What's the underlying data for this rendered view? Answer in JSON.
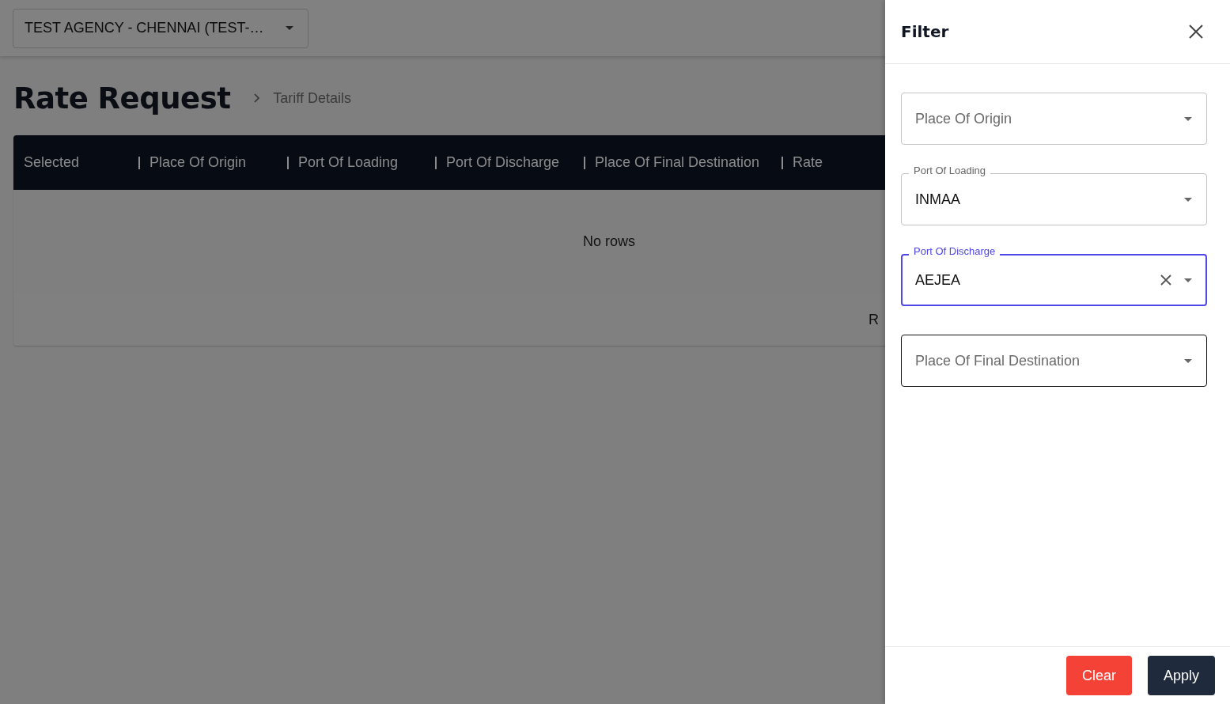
{
  "agency_select": {
    "value": "TEST AGENCY - CHENNAI  (TEST-…"
  },
  "page": {
    "title": "Rate Request",
    "breadcrumb": "Tariff Details"
  },
  "table": {
    "columns": [
      "Selected",
      "Place Of Origin",
      "Port Of Loading",
      "Port Of Discharge",
      "Place Of Final Destination",
      "Rate"
    ],
    "empty_text": "No rows",
    "footer_text": "R"
  },
  "filter": {
    "title": "Filter",
    "fields": [
      {
        "label": "Place Of Origin",
        "focused": false,
        "hovered": false
      },
      {
        "label": "Port Of Loading",
        "value": "INMAA",
        "focused": false,
        "hovered": false
      },
      {
        "label": "Port Of Discharge",
        "value": "AEJEA",
        "focused": true,
        "hovered": false
      },
      {
        "label": "Place Of Final Destination",
        "focused": false,
        "hovered": true
      }
    ],
    "buttons": [
      {
        "label": "Clear",
        "kind": "danger"
      },
      {
        "label": "Apply",
        "kind": "primary"
      }
    ]
  }
}
